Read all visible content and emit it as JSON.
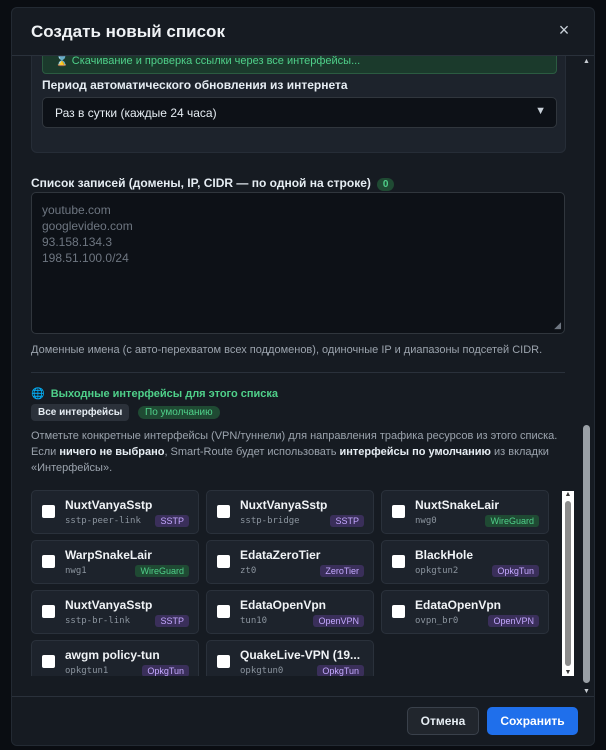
{
  "modal": {
    "title": "Создать новый список",
    "close_label": "×"
  },
  "top_card": {
    "status_text": "⌛ Скачивание и проверка ссылки через все интерфейсы...",
    "period_label": "Период автоматического обновления из интернета",
    "period_value": "Раз в сутки (каждые 24 часа)"
  },
  "entries": {
    "label": "Список записей (домены, IP, CIDR — по одной на строке)",
    "count": "0",
    "placeholder_lines": [
      "youtube.com",
      "googlevideo.com",
      "93.158.134.3",
      "198.51.100.0/24"
    ],
    "help": "Доменные имена (с авто-перехватом всех поддоменов), одиночные IP и диапазоны подсетей CIDR."
  },
  "interfaces": {
    "title": "Выходные интерфейсы для этого списка",
    "chip_all": "Все интерфейсы",
    "chip_default": "По умолчанию",
    "desc_part1": "Отметьте конкретные интерфейсы (VPN/туннели) для направления трафика ресурсов из этого списка. Если ",
    "desc_bold1": "ничего не выбрано",
    "desc_part2": ", Smart-Route будет использовать ",
    "desc_bold2": "интерфейсы по умолчанию",
    "desc_part3": " из вкладки «Интерфейсы».",
    "cards": [
      {
        "name": "NuxtVanyaSstp",
        "dev": "sstp-peer-link",
        "badge": "SSTP"
      },
      {
        "name": "NuxtVanyaSstp",
        "dev": "sstp-bridge",
        "badge": "SSTP"
      },
      {
        "name": "NuxtSnakeLair",
        "dev": "nwg0",
        "badge": "WireGuard"
      },
      {
        "name": "WarpSnakeLair",
        "dev": "nwg1",
        "badge": "WireGuard"
      },
      {
        "name": "EdataZeroTier",
        "dev": "zt0",
        "badge": "ZeroTier"
      },
      {
        "name": "BlackHole",
        "dev": "opkgtun2",
        "badge": "OpkgTun"
      },
      {
        "name": "NuxtVanyaSstp",
        "dev": "sstp-br-link",
        "badge": "SSTP"
      },
      {
        "name": "EdataOpenVpn",
        "dev": "tun10",
        "badge": "OpenVPN"
      },
      {
        "name": "EdataOpenVpn",
        "dev": "ovpn_br0",
        "badge": "OpenVPN"
      },
      {
        "name": "awgm policy-tun",
        "dev": "opkgtun1",
        "badge": "OpkgTun"
      },
      {
        "name": "QuakeLive-VPN (19...",
        "dev": "opkgtun0",
        "badge": "OpkgTun"
      }
    ]
  },
  "footer": {
    "cancel_label": "Отмена",
    "save_label": "Сохранить"
  }
}
